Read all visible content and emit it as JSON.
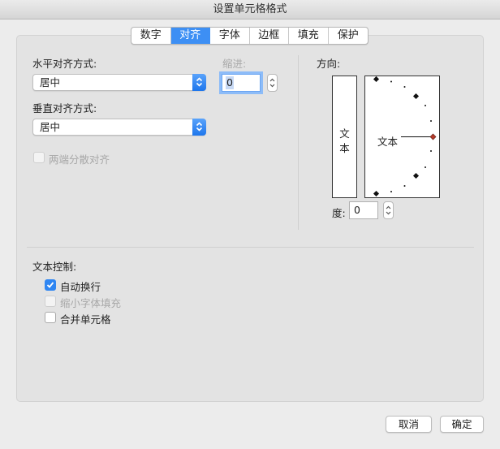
{
  "window": {
    "title": "设置单元格格式"
  },
  "tabs": [
    {
      "label": "数字"
    },
    {
      "label": "对齐"
    },
    {
      "label": "字体"
    },
    {
      "label": "边框"
    },
    {
      "label": "填充"
    },
    {
      "label": "保护"
    }
  ],
  "active_tab": "对齐",
  "alignment": {
    "horizontal_label": "水平对齐方式:",
    "horizontal_value": "居中",
    "vertical_label": "垂直对齐方式:",
    "vertical_value": "居中",
    "indent_label": "缩进:",
    "indent_value": "0",
    "distributed_label": "两端分散对齐",
    "distributed_checked": false,
    "distributed_enabled": false
  },
  "orientation": {
    "label": "方向:",
    "vertical_text": [
      "文",
      "本"
    ],
    "sample_text": "文本",
    "degree_label": "度:",
    "degree_value": "0"
  },
  "text_control": {
    "label": "文本控制:",
    "options": [
      {
        "label": "自动换行",
        "checked": true,
        "enabled": true
      },
      {
        "label": "缩小字体填充",
        "checked": false,
        "enabled": false
      },
      {
        "label": "合并单元格",
        "checked": false,
        "enabled": true
      }
    ]
  },
  "footer": {
    "cancel_label": "取消",
    "ok_label": "确定"
  },
  "colors": {
    "accent": "#3d8ff4",
    "orientation_handle": "#b53a2a"
  }
}
